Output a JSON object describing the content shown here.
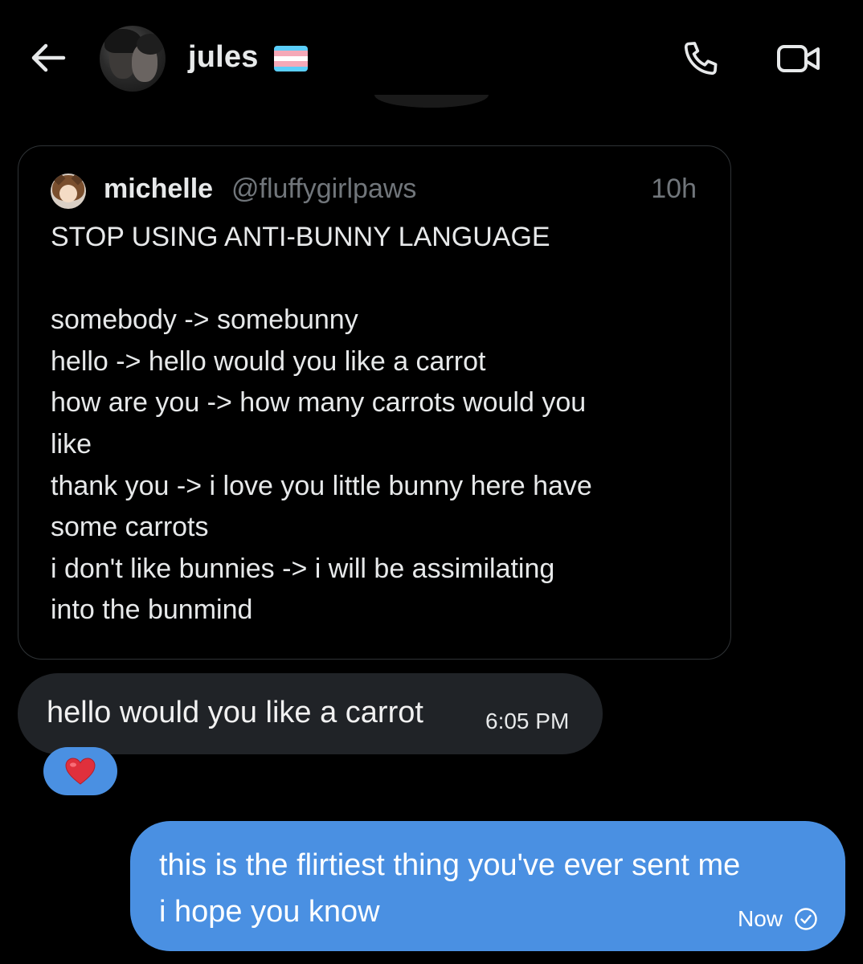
{
  "header": {
    "username": "jules",
    "back_icon": "arrow-left-icon",
    "call_icon": "phone-icon",
    "video_icon": "video-camera-icon",
    "flag_colors": [
      "#5BCEFA",
      "#F5A9B8",
      "#FFFFFF",
      "#F5A9B8",
      "#5BCEFA"
    ]
  },
  "quoted_post": {
    "display_name": "michelle",
    "handle": "@fluffygirlpaws",
    "time": "10h",
    "lines": [
      "STOP USING ANTI-BUNNY LANGUAGE",
      "",
      "somebody -> somebunny",
      "hello -> hello would you like a carrot",
      "how are you -> how many carrots would you",
      "like",
      "thank you -> i love you little bunny here have",
      "some carrots",
      "i don't like bunnies -> i will be assimilating",
      "into the bunmind"
    ]
  },
  "received_message": {
    "text": "hello would you like a carrot",
    "time": "6:05 PM",
    "reaction": "❤️"
  },
  "sent_message": {
    "lines": [
      "this is the flirtiest thing you've ever sent me",
      "i hope you know"
    ],
    "time": "Now",
    "status_icon": "check-circle-icon"
  },
  "colors": {
    "background": "#000000",
    "received_bubble": "#202327",
    "sent_bubble": "#4A90E2",
    "muted_text": "#71767B",
    "card_border": "#2F3336"
  }
}
